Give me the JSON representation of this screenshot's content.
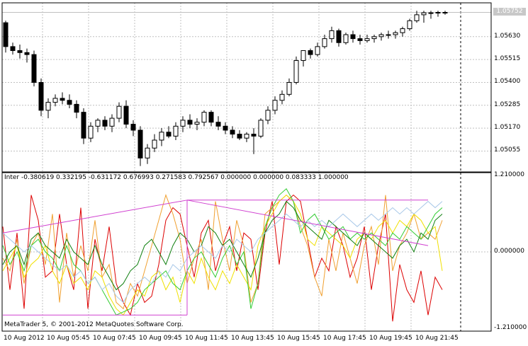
{
  "price_axis": {
    "current_price": "1.05752",
    "labels": [
      "1.05630",
      "1.05515",
      "1.05400",
      "1.05285",
      "1.05170",
      "1.05055"
    ]
  },
  "indicator": {
    "label": "Inter -0.380619 0.332195 -0.631172 0.676993 0.271583 0.792567 0.000000 0.000000 0.083333 1.000000",
    "axis_labels": [
      "1.210000",
      "0.000000",
      "-1.210000"
    ]
  },
  "time_axis": {
    "labels": [
      "10 Aug 2012",
      "10 Aug 05:45",
      "10 Aug 07:45",
      "10 Aug 09:45",
      "10 Aug 11:45",
      "10 Aug 13:45",
      "10 Aug 15:45",
      "10 Aug 17:45",
      "10 Aug 19:45",
      "10 Aug 21:45"
    ]
  },
  "copyright": "MetaTrader 5, © 2001-2012 MetaQuotes Software Corp.",
  "colors": {
    "bull": "#ffffff",
    "bear": "#000000",
    "grid": "#c0c0c0",
    "red": "#dd0000",
    "orange": "#f0a030",
    "yellow": "#f0e000",
    "green": "#33cc33",
    "darkgreen": "#108010",
    "lightblue": "#a8c8e8",
    "magenta": "#d040d0"
  },
  "chart_data": {
    "type": "candlestick",
    "candles": [
      [
        1.057,
        1.0571,
        1.0555,
        1.0558
      ],
      [
        1.0558,
        1.056,
        1.0554,
        1.0556
      ],
      [
        1.0556,
        1.0559,
        1.0552,
        1.0555
      ],
      [
        1.0555,
        1.0557,
        1.055,
        1.0554
      ],
      [
        1.0554,
        1.0556,
        1.0538,
        1.054
      ],
      [
        1.054,
        1.0542,
        1.0523,
        1.0526
      ],
      [
        1.0526,
        1.0532,
        1.0522,
        1.053
      ],
      [
        1.053,
        1.0534,
        1.0528,
        1.0532
      ],
      [
        1.0532,
        1.0535,
        1.0529,
        1.0531
      ],
      [
        1.0531,
        1.0534,
        1.0527,
        1.0529
      ],
      [
        1.0529,
        1.0531,
        1.0522,
        1.0525
      ],
      [
        1.0525,
        1.0527,
        1.0509,
        1.0512
      ],
      [
        1.0512,
        1.052,
        1.051,
        1.0518
      ],
      [
        1.0518,
        1.0522,
        1.0515,
        1.0521
      ],
      [
        1.0521,
        1.0523,
        1.0516,
        1.0518
      ],
      [
        1.0518,
        1.0524,
        1.0515,
        1.0522
      ],
      [
        1.0522,
        1.053,
        1.052,
        1.0528
      ],
      [
        1.0528,
        1.0531,
        1.0517,
        1.0519
      ],
      [
        1.0519,
        1.0521,
        1.0513,
        1.0516
      ],
      [
        1.0516,
        1.0518,
        1.0498,
        1.0502
      ],
      [
        1.0502,
        1.0509,
        1.0499,
        1.0507
      ],
      [
        1.0507,
        1.0514,
        1.0505,
        1.0511
      ],
      [
        1.0511,
        1.0517,
        1.0508,
        1.0515
      ],
      [
        1.0515,
        1.0518,
        1.0512,
        1.0513
      ],
      [
        1.0513,
        1.052,
        1.0511,
        1.0518
      ],
      [
        1.0518,
        1.0523,
        1.0515,
        1.0521
      ],
      [
        1.0521,
        1.0524,
        1.0517,
        1.0519
      ],
      [
        1.0519,
        1.0522,
        1.0516,
        1.052
      ],
      [
        1.052,
        1.0526,
        1.0518,
        1.0525
      ],
      [
        1.0525,
        1.0526,
        1.0518,
        1.052
      ],
      [
        1.052,
        1.0523,
        1.0516,
        1.0518
      ],
      [
        1.0518,
        1.052,
        1.0514,
        1.0516
      ],
      [
        1.0516,
        1.0518,
        1.0512,
        1.0514
      ],
      [
        1.0514,
        1.0516,
        1.0511,
        1.0512
      ],
      [
        1.0512,
        1.0515,
        1.051,
        1.0514
      ],
      [
        1.0514,
        1.0517,
        1.0504,
        1.0513
      ],
      [
        1.0513,
        1.0522,
        1.0512,
        1.0521
      ],
      [
        1.0521,
        1.0528,
        1.0519,
        1.0526
      ],
      [
        1.0526,
        1.0533,
        1.0524,
        1.0531
      ],
      [
        1.0531,
        1.0536,
        1.0529,
        1.0534
      ],
      [
        1.0534,
        1.0542,
        1.0533,
        1.054
      ],
      [
        1.054,
        1.0553,
        1.0539,
        1.0551
      ],
      [
        1.0551,
        1.0556,
        1.0548,
        1.0556
      ],
      [
        1.0556,
        1.0557,
        1.0552,
        1.0554
      ],
      [
        1.0554,
        1.056,
        1.0553,
        1.0558
      ],
      [
        1.0558,
        1.0564,
        1.0557,
        1.0562
      ],
      [
        1.0562,
        1.0568,
        1.056,
        1.0566
      ],
      [
        1.0566,
        1.0567,
        1.0558,
        1.056
      ],
      [
        1.056,
        1.0565,
        1.0559,
        1.0564
      ],
      [
        1.0564,
        1.0566,
        1.056,
        1.0562
      ],
      [
        1.0562,
        1.0564,
        1.0559,
        1.0561
      ],
      [
        1.0561,
        1.0564,
        1.056,
        1.0562
      ],
      [
        1.0562,
        1.0564,
        1.056,
        1.0563
      ],
      [
        1.0563,
        1.0565,
        1.0561,
        1.0564
      ],
      [
        1.0564,
        1.0566,
        1.0562,
        1.0564
      ],
      [
        1.0564,
        1.0566,
        1.0562,
        1.0565
      ],
      [
        1.0565,
        1.0568,
        1.0563,
        1.0567
      ],
      [
        1.0567,
        1.0572,
        1.0566,
        1.0571
      ],
      [
        1.0571,
        1.0576,
        1.057,
        1.0574
      ],
      [
        1.0574,
        1.0576,
        1.057,
        1.0575
      ],
      [
        1.0575,
        1.0576,
        1.0572,
        1.0575
      ],
      [
        1.0575,
        1.0576,
        1.0573,
        1.05752
      ],
      [
        1.05752,
        1.0576,
        1.0574,
        1.05752
      ]
    ],
    "indicator_series": [
      {
        "color": "red",
        "values": [
          0.4,
          -0.6,
          0.3,
          -0.9,
          0.9,
          0.5,
          -0.4,
          -0.3,
          0.6,
          -0.2,
          -0.6,
          0.7,
          -0.9,
          0.2,
          -0.3,
          0.4,
          -0.5,
          -0.8,
          -1.0,
          -0.5,
          -0.8,
          -0.7,
          -0.2,
          0.5,
          0.7,
          0.6,
          0.1,
          -0.4,
          0.3,
          0.5,
          -0.3,
          0.1,
          0.4,
          -0.3,
          0.3,
          0.2,
          -0.6,
          0.3,
          0.8,
          -0.2,
          0.8,
          0.9,
          0.8,
          0.2,
          -0.4,
          -0.1,
          -0.3,
          0.4,
          0.1,
          -0.4,
          -0.1,
          0.4,
          -0.6,
          0.1,
          0.6,
          -1.1,
          -0.2,
          -0.6,
          -0.8,
          -0.3,
          -1.0,
          -0.4,
          -0.6
        ]
      },
      {
        "color": "orange",
        "values": [
          -0.1,
          -0.3,
          0.2,
          -0.5,
          0.1,
          0.3,
          -0.2,
          0.6,
          -0.8,
          0.3,
          -0.4,
          0.1,
          -0.3,
          0.5,
          -0.4,
          -0.2,
          -0.8,
          -0.9,
          -0.5,
          -0.7,
          -0.3,
          0.1,
          0.5,
          0.9,
          0.6,
          0.2,
          -0.5,
          -0.1,
          0.2,
          -0.6,
          0.8,
          0.2,
          -0.3,
          0.5,
          0.1,
          -0.8,
          -0.5,
          0.6,
          0.7,
          0.8,
          0.9,
          0.8,
          0.4,
          0.1,
          -0.4,
          -0.7,
          0.2,
          -0.3,
          0.3,
          -0.1,
          -0.5,
          0.1,
          0.4,
          -0.2,
          0.9,
          -0.3,
          0.1,
          0.3,
          0.6,
          0.2,
          0.3,
          0.2,
          0.5
        ]
      },
      {
        "color": "yellow",
        "values": [
          -0.3,
          -0.1,
          0.1,
          -0.4,
          -0.2,
          -0.1,
          0.1,
          -0.3,
          -0.5,
          -0.2,
          -0.5,
          -0.4,
          -0.6,
          -0.3,
          -0.4,
          -0.7,
          -0.9,
          -1.0,
          -0.8,
          -0.6,
          -0.7,
          -0.4,
          -0.3,
          -0.6,
          -0.4,
          -0.8,
          -0.3,
          -0.5,
          -0.1,
          -0.4,
          -0.6,
          -0.3,
          -0.5,
          -0.2,
          -0.4,
          -0.6,
          0.1,
          0.4,
          0.6,
          0.8,
          0.9,
          0.8,
          0.6,
          0.2,
          0.1,
          0.4,
          0.3,
          0.2,
          0.1,
          -0.1,
          0.2,
          0.3,
          0.2,
          0.4,
          0.5,
          0.3,
          0.5,
          0.4,
          0.6,
          0.5,
          0.3,
          0.4,
          -0.3
        ]
      },
      {
        "color": "green",
        "values": [
          0.1,
          -0.2,
          0.0,
          -0.3,
          0.1,
          0.2,
          0.0,
          -0.1,
          -0.3,
          0.1,
          -0.2,
          -0.3,
          -0.5,
          -0.4,
          -0.6,
          -0.8,
          -1.0,
          -0.95,
          -0.9,
          -0.8,
          -0.6,
          -0.5,
          -0.4,
          -0.3,
          -0.5,
          -0.6,
          -0.3,
          -0.1,
          0.0,
          -0.2,
          -0.4,
          -0.1,
          0.1,
          -0.2,
          0.0,
          -0.9,
          -0.5,
          0.4,
          0.7,
          0.9,
          1.0,
          0.8,
          0.3,
          0.5,
          0.6,
          0.4,
          0.2,
          0.3,
          0.4,
          0.2,
          0.3,
          0.2,
          0.3,
          0.2,
          0.1,
          0.3,
          0.2,
          0.4,
          0.3,
          0.2,
          0.4,
          0.6,
          0.7
        ]
      },
      {
        "color": "darkgreen",
        "values": [
          -0.2,
          0.0,
          0.1,
          -0.2,
          0.2,
          0.3,
          0.1,
          0.0,
          -0.1,
          0.2,
          0.0,
          -0.1,
          -0.2,
          0.1,
          -0.2,
          -0.4,
          -0.6,
          -0.5,
          -0.3,
          -0.2,
          0.1,
          0.2,
          0.0,
          -0.2,
          0.1,
          0.3,
          0.2,
          0.0,
          0.1,
          0.4,
          0.3,
          0.1,
          0.2,
          0.0,
          -0.2,
          -0.4,
          -0.1,
          0.3,
          0.5,
          0.6,
          0.8,
          0.7,
          0.5,
          0.4,
          0.3,
          0.2,
          0.5,
          0.4,
          0.3,
          0.2,
          0.1,
          0.3,
          0.2,
          0.1,
          0.0,
          -0.1,
          0.1,
          0.2,
          0.0,
          0.3,
          0.2,
          0.5,
          0.6
        ]
      },
      {
        "color": "lightblue",
        "values": [
          0.3,
          0.2,
          0.1,
          0.0,
          0.1,
          0.0,
          -0.1,
          -0.2,
          -0.3,
          -0.2,
          -0.4,
          -0.3,
          -0.5,
          -0.4,
          -0.6,
          -0.5,
          -0.7,
          -0.8,
          -0.6,
          -0.5,
          -0.4,
          -0.5,
          -0.3,
          -0.4,
          -0.2,
          -0.3,
          -0.1,
          0.0,
          0.1,
          0.0,
          -0.1,
          0.1,
          0.0,
          0.2,
          0.1,
          0.0,
          0.2,
          0.3,
          0.4,
          0.5,
          0.6,
          0.5,
          0.4,
          0.5,
          0.4,
          0.5,
          0.4,
          0.5,
          0.6,
          0.5,
          0.4,
          0.5,
          0.6,
          0.5,
          0.6,
          0.7,
          0.6,
          0.7,
          0.6,
          0.7,
          0.8,
          0.7,
          0.8
        ]
      }
    ],
    "trend_lines": [
      {
        "color": "magenta",
        "points": [
          [
            0,
            0.3
          ],
          [
            26,
            0.82
          ]
        ]
      },
      {
        "color": "magenta",
        "points": [
          [
            26,
            0.82
          ],
          [
            60,
            0.1
          ]
        ]
      },
      {
        "color": "magenta",
        "points": [
          [
            26,
            0.82
          ],
          [
            60,
            0.82
          ]
        ]
      },
      {
        "color": "magenta",
        "points": [
          [
            26,
            0.82
          ],
          [
            26,
            -1.0
          ]
        ]
      },
      {
        "color": "magenta",
        "points": [
          [
            0,
            -1.0
          ],
          [
            26,
            -1.0
          ]
        ]
      }
    ],
    "price_ylim": [
      1.0495,
      1.058
    ],
    "indicator_ylim": [
      -1.21,
      1.21
    ]
  }
}
